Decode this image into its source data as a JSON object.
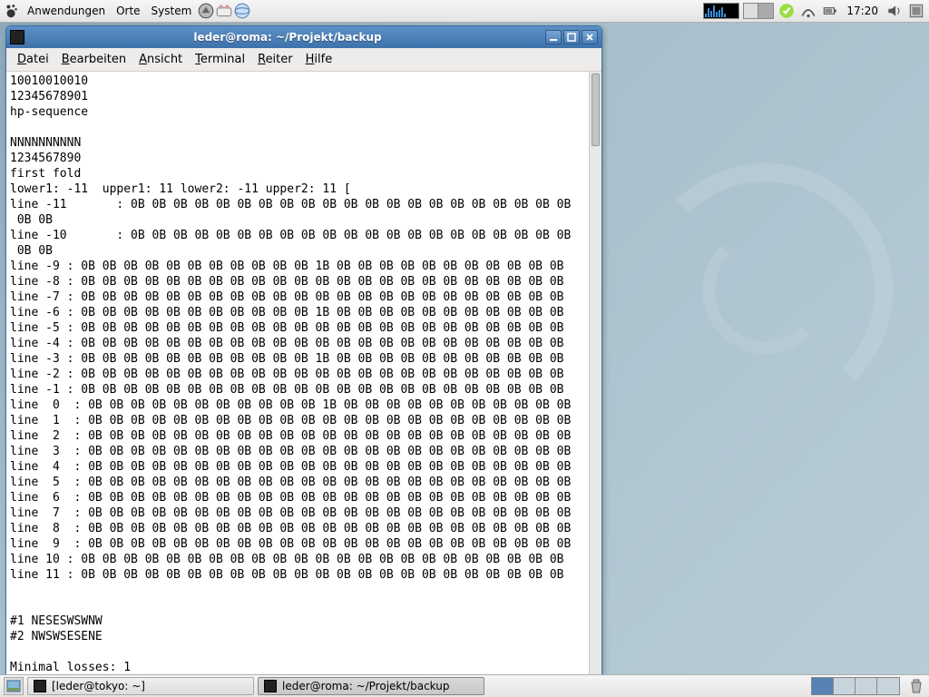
{
  "top_panel": {
    "menus": [
      "Anwendungen",
      "Orte",
      "System"
    ],
    "clock": "17:20"
  },
  "window": {
    "title": "leder@roma: ~/Projekt/backup",
    "menubar": [
      {
        "label": "Datei",
        "ul": "D",
        "rest": "atei"
      },
      {
        "label": "Bearbeiten",
        "ul": "B",
        "rest": "earbeiten"
      },
      {
        "label": "Ansicht",
        "ul": "A",
        "rest": "nsicht"
      },
      {
        "label": "Terminal",
        "ul": "T",
        "rest": "erminal"
      },
      {
        "label": "Reiter",
        "ul": "R",
        "rest": "eiter"
      },
      {
        "label": "Hilfe",
        "ul": "H",
        "rest": "ilfe"
      }
    ]
  },
  "terminal_lines": [
    "10010010010",
    "12345678901",
    "hp-sequence",
    "",
    "NNNNNNNNNN",
    "1234567890",
    "first fold",
    "lower1: -11  upper1: 11 lower2: -11 upper2: 11 [",
    "line -11       : 0B 0B 0B 0B 0B 0B 0B 0B 0B 0B 0B 0B 0B 0B 0B 0B 0B 0B 0B 0B 0B",
    " 0B 0B",
    "line -10       : 0B 0B 0B 0B 0B 0B 0B 0B 0B 0B 0B 0B 0B 0B 0B 0B 0B 0B 0B 0B 0B",
    " 0B 0B",
    "line -9 : 0B 0B 0B 0B 0B 0B 0B 0B 0B 0B 0B 1B 0B 0B 0B 0B 0B 0B 0B 0B 0B 0B 0B",
    "line -8 : 0B 0B 0B 0B 0B 0B 0B 0B 0B 0B 0B 0B 0B 0B 0B 0B 0B 0B 0B 0B 0B 0B 0B",
    "line -7 : 0B 0B 0B 0B 0B 0B 0B 0B 0B 0B 0B 0B 0B 0B 0B 0B 0B 0B 0B 0B 0B 0B 0B",
    "line -6 : 0B 0B 0B 0B 0B 0B 0B 0B 0B 0B 0B 1B 0B 0B 0B 0B 0B 0B 0B 0B 0B 0B 0B",
    "line -5 : 0B 0B 0B 0B 0B 0B 0B 0B 0B 0B 0B 0B 0B 0B 0B 0B 0B 0B 0B 0B 0B 0B 0B",
    "line -4 : 0B 0B 0B 0B 0B 0B 0B 0B 0B 0B 0B 0B 0B 0B 0B 0B 0B 0B 0B 0B 0B 0B 0B",
    "line -3 : 0B 0B 0B 0B 0B 0B 0B 0B 0B 0B 0B 1B 0B 0B 0B 0B 0B 0B 0B 0B 0B 0B 0B",
    "line -2 : 0B 0B 0B 0B 0B 0B 0B 0B 0B 0B 0B 0B 0B 0B 0B 0B 0B 0B 0B 0B 0B 0B 0B",
    "line -1 : 0B 0B 0B 0B 0B 0B 0B 0B 0B 0B 0B 0B 0B 0B 0B 0B 0B 0B 0B 0B 0B 0B 0B",
    "line  0  : 0B 0B 0B 0B 0B 0B 0B 0B 0B 0B 0B 1B 0B 0B 0B 0B 0B 0B 0B 0B 0B 0B 0B",
    "line  1  : 0B 0B 0B 0B 0B 0B 0B 0B 0B 0B 0B 0B 0B 0B 0B 0B 0B 0B 0B 0B 0B 0B 0B",
    "line  2  : 0B 0B 0B 0B 0B 0B 0B 0B 0B 0B 0B 0B 0B 0B 0B 0B 0B 0B 0B 0B 0B 0B 0B",
    "line  3  : 0B 0B 0B 0B 0B 0B 0B 0B 0B 0B 0B 0B 0B 0B 0B 0B 0B 0B 0B 0B 0B 0B 0B",
    "line  4  : 0B 0B 0B 0B 0B 0B 0B 0B 0B 0B 0B 0B 0B 0B 0B 0B 0B 0B 0B 0B 0B 0B 0B",
    "line  5  : 0B 0B 0B 0B 0B 0B 0B 0B 0B 0B 0B 0B 0B 0B 0B 0B 0B 0B 0B 0B 0B 0B 0B",
    "line  6  : 0B 0B 0B 0B 0B 0B 0B 0B 0B 0B 0B 0B 0B 0B 0B 0B 0B 0B 0B 0B 0B 0B 0B",
    "line  7  : 0B 0B 0B 0B 0B 0B 0B 0B 0B 0B 0B 0B 0B 0B 0B 0B 0B 0B 0B 0B 0B 0B 0B",
    "line  8  : 0B 0B 0B 0B 0B 0B 0B 0B 0B 0B 0B 0B 0B 0B 0B 0B 0B 0B 0B 0B 0B 0B 0B",
    "line  9  : 0B 0B 0B 0B 0B 0B 0B 0B 0B 0B 0B 0B 0B 0B 0B 0B 0B 0B 0B 0B 0B 0B 0B",
    "line 10 : 0B 0B 0B 0B 0B 0B 0B 0B 0B 0B 0B 0B 0B 0B 0B 0B 0B 0B 0B 0B 0B 0B 0B",
    "line 11 : 0B 0B 0B 0B 0B 0B 0B 0B 0B 0B 0B 0B 0B 0B 0B 0B 0B 0B 0B 0B 0B 0B 0B",
    "",
    "",
    "#1 NESESWSWNW",
    "#2 NWSWSESENE",
    "",
    "Minimal losses: 1"
  ],
  "taskbar": {
    "tasks": [
      {
        "label": "[leder@tokyo: ~]",
        "active": false
      },
      {
        "label": "leder@roma: ~/Projekt/backup",
        "active": true
      }
    ]
  }
}
